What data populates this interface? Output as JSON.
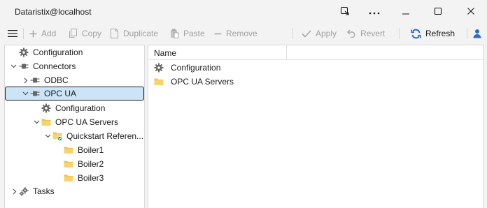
{
  "window": {
    "title": "Dataristix@localhost"
  },
  "toolbar": {
    "add": "Add",
    "copy": "Copy",
    "duplicate": "Duplicate",
    "paste": "Paste",
    "remove": "Remove",
    "apply": "Apply",
    "revert": "Revert",
    "refresh": "Refresh"
  },
  "tree": {
    "configuration": "Configuration",
    "connectors": "Connectors",
    "odbc": "ODBC",
    "opcua": "OPC UA",
    "opcua_configuration": "Configuration",
    "opcua_servers": "OPC UA Servers",
    "quickstart": "Quickstart Referen...",
    "boiler1": "Boiler1",
    "boiler2": "Boiler2",
    "boiler3": "Boiler3",
    "tasks": "Tasks"
  },
  "list": {
    "column_name": "Name",
    "items": [
      "Configuration",
      "OPC UA Servers"
    ]
  },
  "colors": {
    "selection": "#cce4f7",
    "folder": "#f0c24e",
    "refresh_icon": "#2b6cc4",
    "user_icon": "#2b6cc4",
    "status_ok": "#22a06b"
  }
}
